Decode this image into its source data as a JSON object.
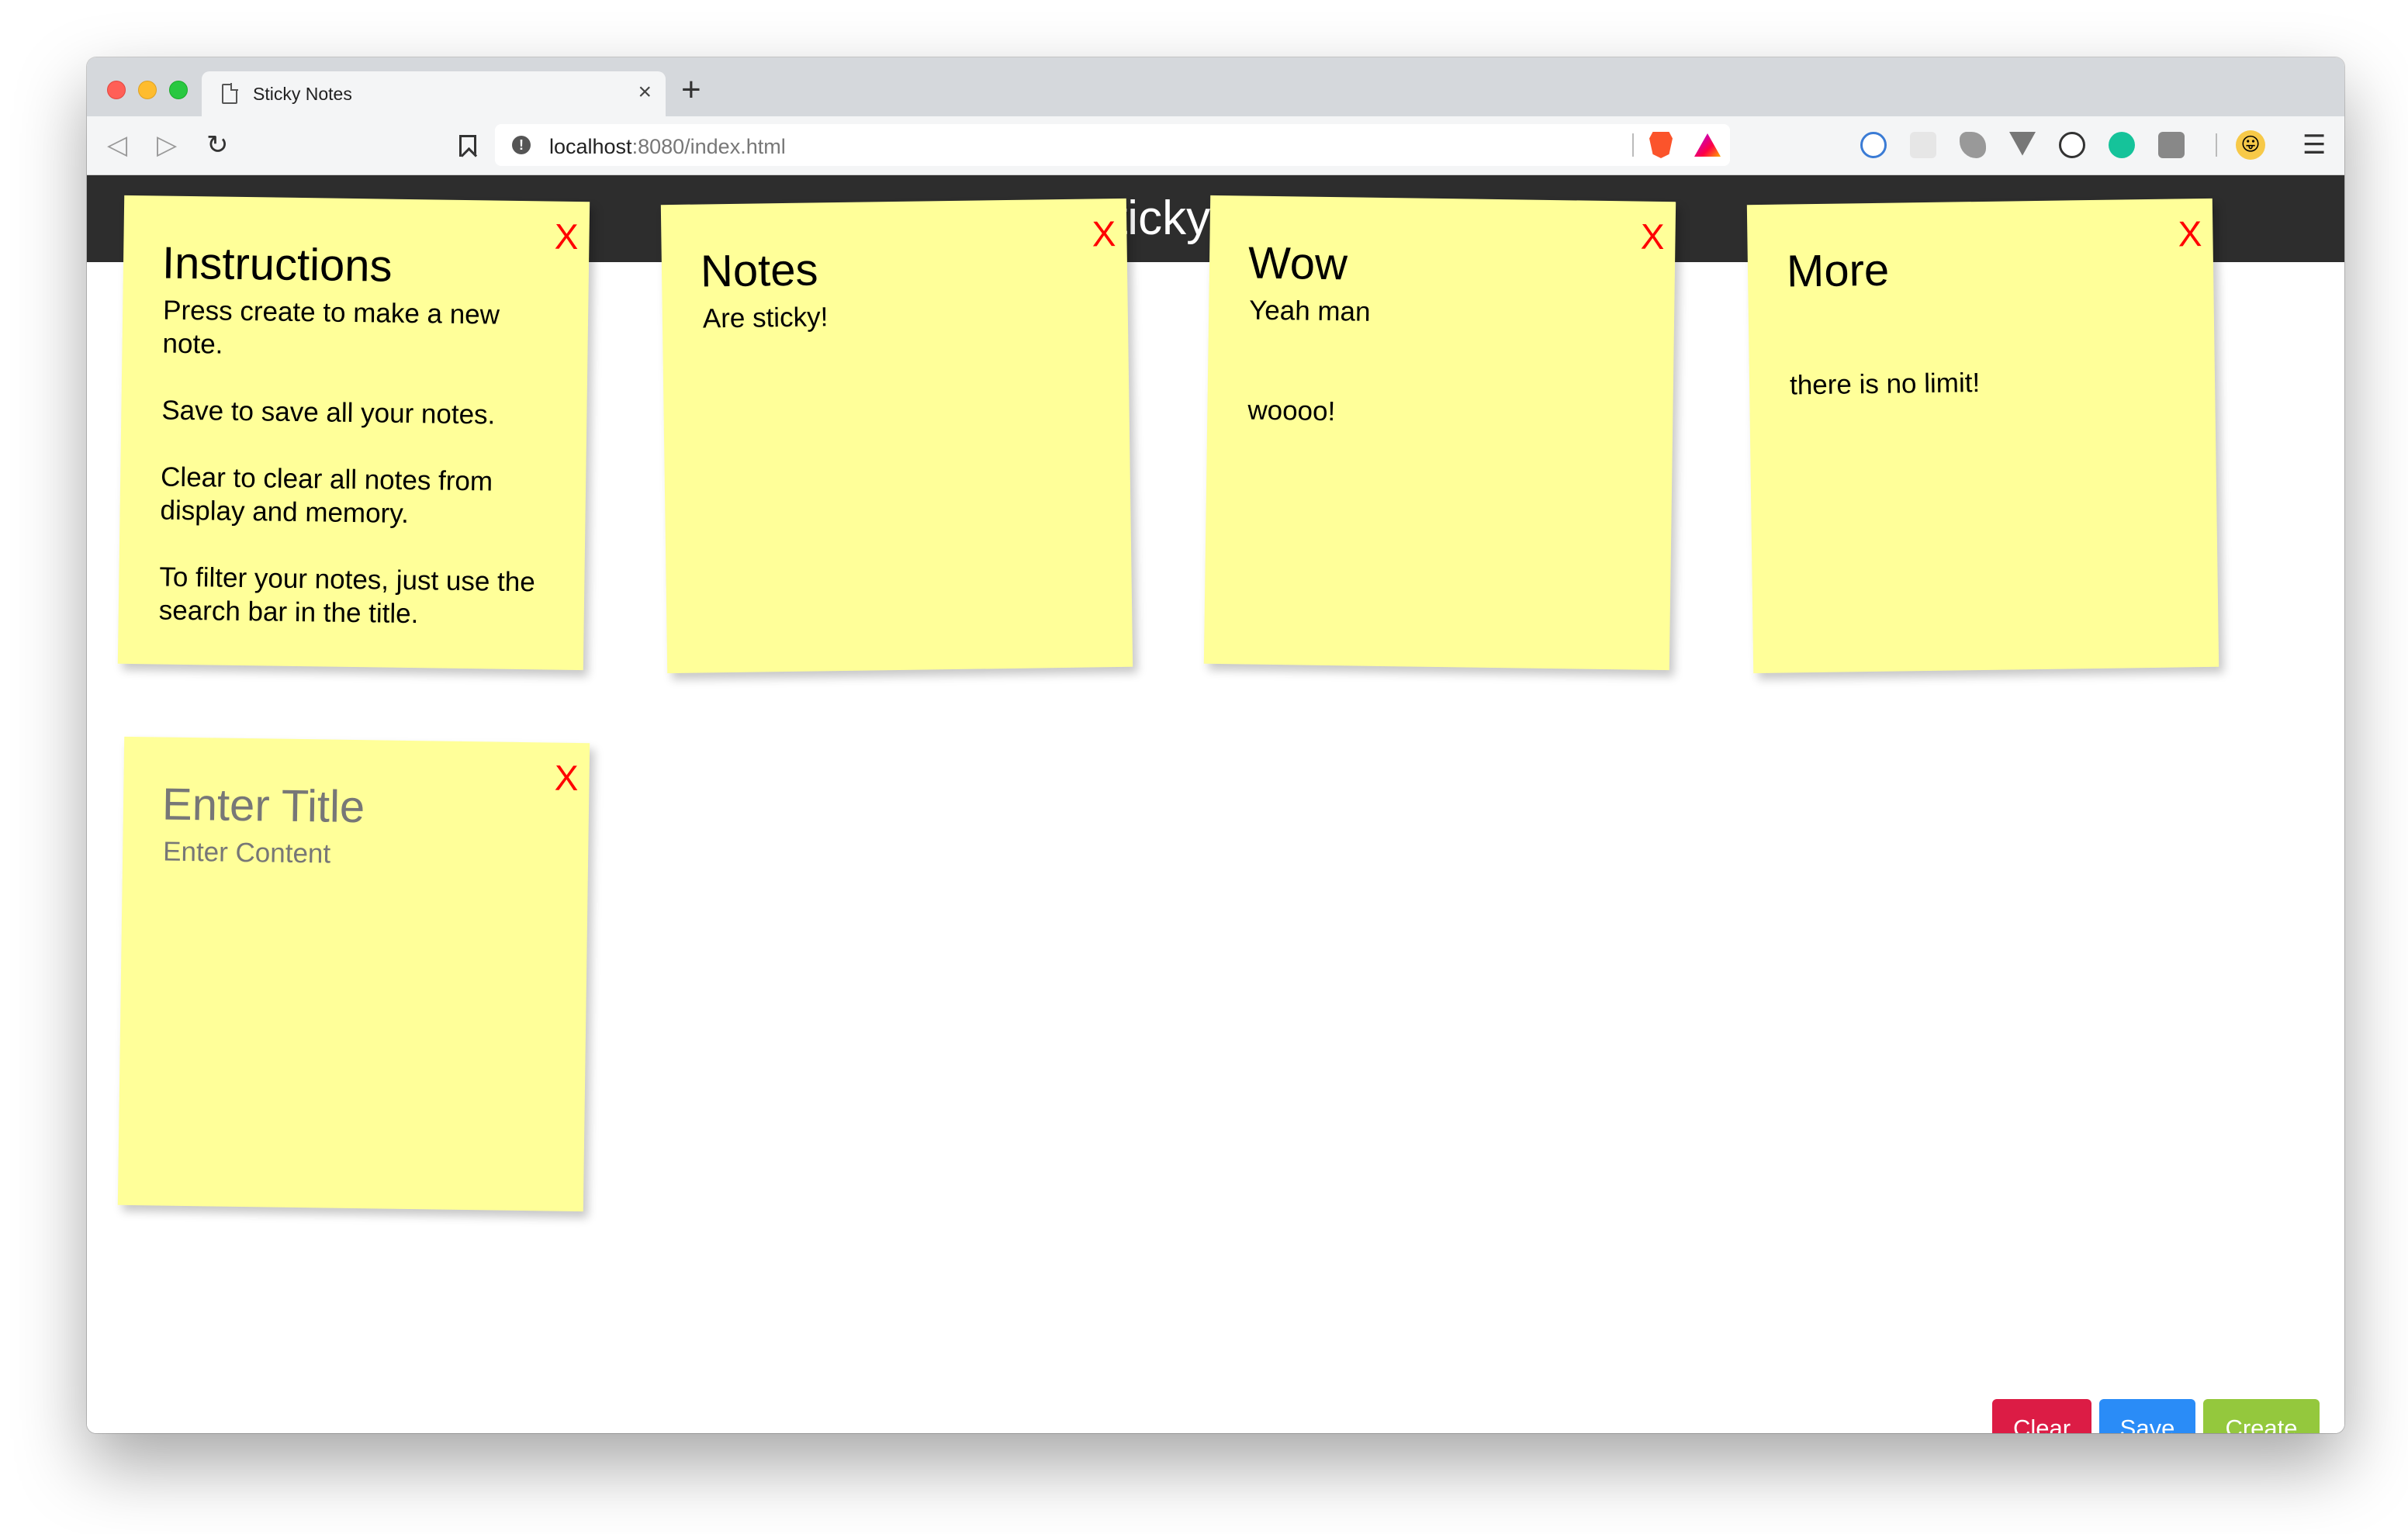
{
  "browser": {
    "tab_title": "Sticky Notes",
    "tab_close": "×",
    "new_tab": "+",
    "url_host": "localhost",
    "url_path": ":8080/index.html",
    "menu_glyph": "☰"
  },
  "app": {
    "title": "Sticky Notes"
  },
  "notes": [
    {
      "title": "Instructions",
      "close": "X",
      "lines": [
        "Press create to make a new note.",
        "",
        "Save to save all your notes.",
        "",
        "Clear to clear all notes from display and memory.",
        "",
        "To filter your notes, just use the search bar in the title."
      ]
    },
    {
      "title": "Notes",
      "close": "X",
      "lines": [
        "Are sticky!"
      ]
    },
    {
      "title": "Wow",
      "close": "X",
      "lines": [
        "Yeah man",
        "",
        "",
        "woooo!"
      ]
    },
    {
      "title": "More",
      "close": "X",
      "lines": [
        "",
        "",
        "there is no limit!"
      ]
    },
    {
      "title_placeholder": "Enter Title",
      "content_placeholder": "Enter Content",
      "close": "X"
    }
  ],
  "buttons": {
    "clear": "Clear",
    "save": "Save",
    "create": "Create"
  },
  "colors": {
    "note": "#ffff99",
    "header": "#2d2d2d",
    "close": "#ff0000",
    "clear": "#dc1c45",
    "save": "#2a8cf7",
    "create": "#94c83d"
  }
}
